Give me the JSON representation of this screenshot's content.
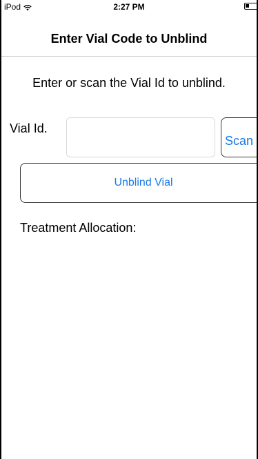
{
  "status_bar": {
    "device": "iPod",
    "time": "2:27 PM"
  },
  "nav": {
    "title": "Enter Vial Code to Unblind"
  },
  "main": {
    "instruction": "Enter or scan the Vial Id to unblind.",
    "vial_label": "Vial Id.",
    "vial_input_value": "",
    "vial_input_placeholder": "",
    "scan_label": "Scan",
    "unblind_label": "Unblind Vial",
    "treatment_label": "Treatment Allocation:",
    "treatment_value": ""
  },
  "colors": {
    "accent": "#1a7be6",
    "text": "#000000",
    "separator": "#c8c7cc"
  }
}
